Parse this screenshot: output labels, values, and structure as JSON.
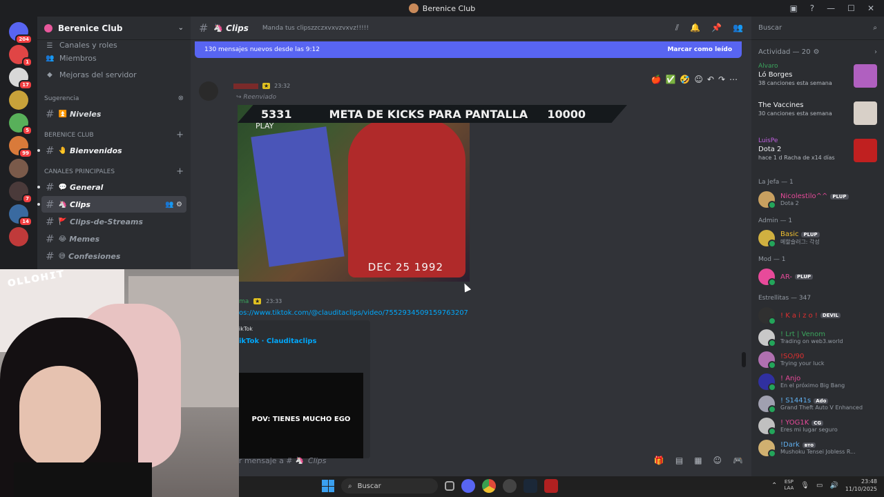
{
  "window": {
    "title": "Berenice Club"
  },
  "guilds": [
    {
      "badge": "204",
      "color": "#5865f2"
    },
    {
      "badge": "1",
      "color": "#e04545"
    },
    {
      "badge": "17",
      "color": "#d8d8d8"
    },
    {
      "badge": "",
      "color": "#c8a23a"
    },
    {
      "badge": "5",
      "color": "#58b05a"
    },
    {
      "badge": "99",
      "color": "#d97a3a"
    },
    {
      "badge": "",
      "color": "#7a5a4a"
    },
    {
      "badge": "7",
      "color": "#4a3a3a"
    },
    {
      "badge": "14",
      "color": "#3a6aa0"
    },
    {
      "badge": "",
      "color": "#c03a3a"
    }
  ],
  "sidebar": {
    "server_name": "Berenice Club",
    "nav": [
      {
        "label": "Canales y roles"
      },
      {
        "label": "Miembros"
      },
      {
        "label": "Mejoras del servidor"
      }
    ],
    "suggestion_label": "Sugerencia",
    "suggested_channel": {
      "emoji": "⏫",
      "name": "Niveles"
    },
    "cat1": "BERENICE CLUB",
    "cat1_channels": [
      {
        "emoji": "🤚",
        "name": "Bienvenidos"
      }
    ],
    "cat2": "CANALES PRINCIPALES",
    "cat2_channels": [
      {
        "emoji": "💬",
        "name": "General"
      },
      {
        "emoji": "🦄",
        "name": "Clips"
      },
      {
        "emoji": "🚩",
        "name": "Clips-de-Streams"
      },
      {
        "emoji": "😂",
        "name": "Memes"
      },
      {
        "emoji": "😅",
        "name": "Confesiones"
      }
    ]
  },
  "channel": {
    "name": "Clips",
    "emoji": "🦄",
    "topic": "Manda tus clipszzczxvxvzvxvz!!!!!"
  },
  "new_messages": {
    "text": "130 mensajes nuevos desde las 9:12",
    "mark_read": "Marcar como leído"
  },
  "message1": {
    "time": "23:32",
    "forwarded": "Reenviado",
    "video": {
      "date": "DEC 25 1992",
      "play": "PLAY"
    },
    "kick_bar": {
      "left": "5331",
      "middle": "META DE KICKS PARA PANTALLA",
      "right": "10000"
    }
  },
  "message2": {
    "user": "ma",
    "time": "23:33",
    "link": "os://www.tiktok.com/@clauditaclips/video/7552934509159763207",
    "embed_provider": "ikTok",
    "embed_title": "ikTok · Clauditaclips",
    "thumb_caption": "POV: TIENES MUCHO EGO"
  },
  "input": {
    "placeholder": "iar mensaje a #",
    "channel": "Clips"
  },
  "right_panel": {
    "search_placeholder": "Buscar",
    "activity_header": "Actividad — 20",
    "activities": [
      {
        "who": "Alvaro",
        "who_color": "#3ba55d",
        "game": "Ló Borges",
        "meta": "38 canciones esta semana",
        "art": "#b060c0"
      },
      {
        "who": "",
        "who_color": "#e03030",
        "game": "The Vaccines",
        "meta": "30 canciones esta semana",
        "art": "#d8d0c8"
      },
      {
        "who": "LuisPe",
        "who_color": "#c060e0",
        "game": "Dota 2",
        "meta": "hace 1 d   Racha de x14 días",
        "art": "#c02020"
      }
    ],
    "groups": [
      {
        "title": "La Jefa — 1",
        "members": [
          {
            "name": "Nicolestilo^^",
            "color": "#e84a9a",
            "tag": "PLUP",
            "status": "Dota 2",
            "av": "#c8a060"
          }
        ]
      },
      {
        "title": "Admin — 1",
        "members": [
          {
            "name": "Basic",
            "color": "#f0c030",
            "tag": "PLUP",
            "status": "메할슬러그: 각성",
            "av": "#d0b040"
          }
        ]
      },
      {
        "title": "Mod — 1",
        "members": [
          {
            "name": "AR-",
            "color": "#e84a9a",
            "tag": "PLUP",
            "status": "",
            "av": "#e84a9a"
          }
        ]
      },
      {
        "title": "Estrellitas — 347",
        "members": [
          {
            "name": "! K a i z o !",
            "color": "#e03030",
            "tag": "DEVIL",
            "status": "",
            "av": "#303030"
          },
          {
            "name": "! Lrt | Venom",
            "color": "#3ba55d",
            "tag": "",
            "status": "Trading on web3.world",
            "av": "#c8c8c8"
          },
          {
            "name": "!SO/90",
            "color": "#e03030",
            "tag": "",
            "status": "Trying your luck",
            "av": "#b070b0"
          },
          {
            "name": "! Anjo",
            "color": "#e84a9a",
            "tag": "",
            "status": "En el próximo Big Bang",
            "av": "#3030a0"
          },
          {
            "name": "! S1441s",
            "color": "#60b0f0",
            "tag": "Ado",
            "status": "Grand Theft Auto V Enhanced",
            "av": "#a0a0b0"
          },
          {
            "name": "! YOG1K",
            "color": "#e84a9a",
            "tag": "CG",
            "status": "Eres mi lugar seguro",
            "av": "#c0c0c0"
          },
          {
            "name": "!Dark",
            "color": "#60b0f0",
            "tag": "вто",
            "status": "Mushoku Tensei Jobless R...",
            "av": "#d0b070"
          }
        ]
      }
    ]
  },
  "taskbar": {
    "search": "Buscar",
    "lang_top": "ESP",
    "lang_bottom": "LAA",
    "time": "23:48",
    "date": "11/10/2025"
  }
}
